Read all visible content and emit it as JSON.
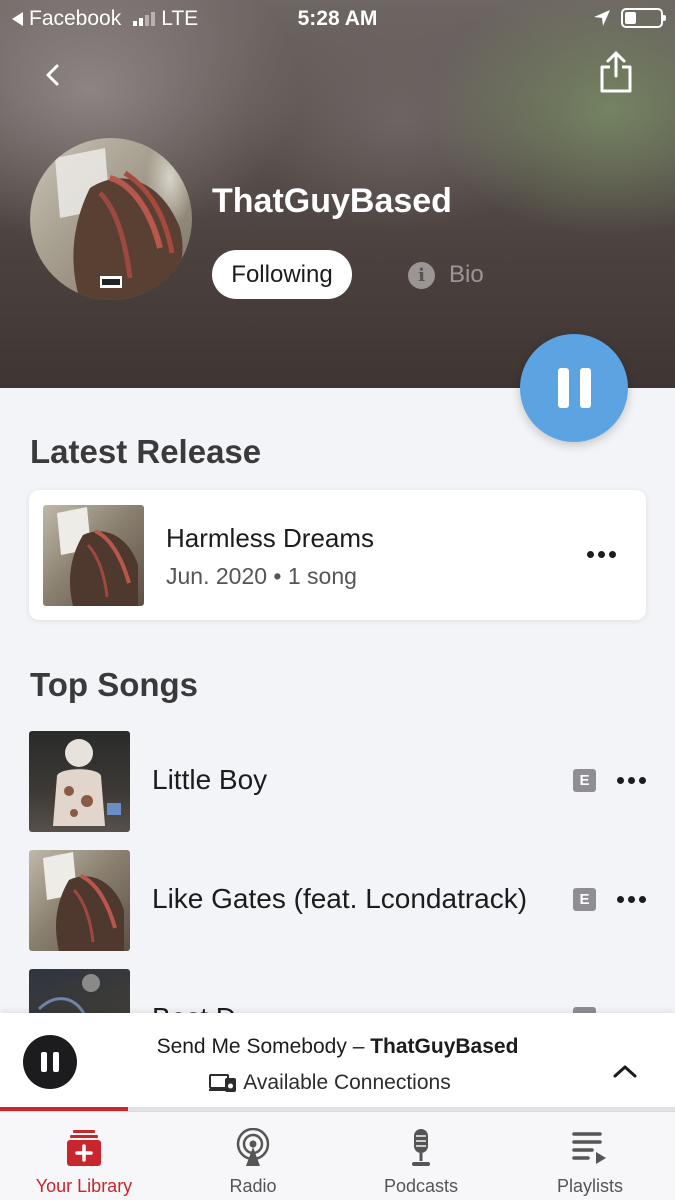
{
  "status_bar": {
    "back_app": "Facebook",
    "network": "LTE",
    "time": "5:28 AM"
  },
  "artist": {
    "name": "ThatGuyBased",
    "follow_label": "Following",
    "bio_label": "Bio"
  },
  "latest_release": {
    "heading": "Latest Release",
    "title": "Harmless Dreams",
    "meta": "Jun. 2020 • 1 song"
  },
  "top_songs": {
    "heading": "Top Songs",
    "songs": [
      {
        "title": "Little Boy",
        "explicit": "E"
      },
      {
        "title": "Like Gates (feat. Lcondatrack)",
        "explicit": "E"
      },
      {
        "title": "Best D...",
        "explicit": "E"
      }
    ]
  },
  "mini_player": {
    "track": "Send Me Somebody",
    "separator": " – ",
    "artist": "ThatGuyBased",
    "connections": "Available Connections",
    "progress": 0.19
  },
  "tabs": [
    {
      "label": "Your Library",
      "icon": "library-icon",
      "active": true
    },
    {
      "label": "Radio",
      "icon": "radio-icon",
      "active": false
    },
    {
      "label": "Podcasts",
      "icon": "microphone-icon",
      "active": false
    },
    {
      "label": "Playlists",
      "icon": "playlist-icon",
      "active": false
    }
  ],
  "colors": {
    "accent_red": "#c9252c",
    "play_blue": "#5ba3e1"
  }
}
